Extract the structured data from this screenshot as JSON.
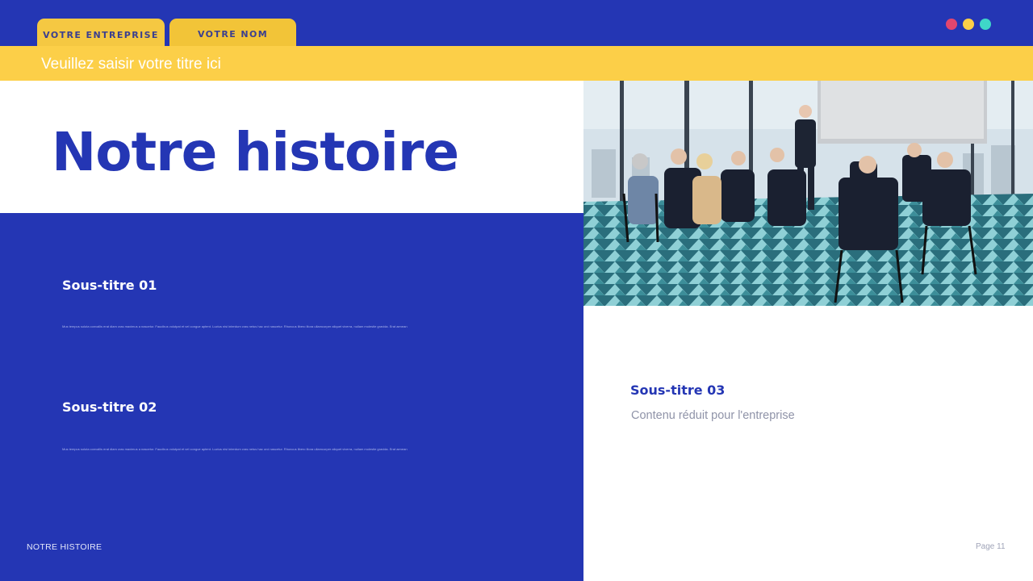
{
  "header": {
    "tab_company": "VOTRE ENTREPRISE",
    "tab_name": "VOTRE NOM",
    "band_title": "Veuillez saisir votre titre ici",
    "dots": [
      {
        "name": "pink-dot",
        "color": "#e2466e"
      },
      {
        "name": "yellow-dot",
        "color": "#fccf48"
      },
      {
        "name": "teal-dot",
        "color": "#3fd6c8"
      }
    ]
  },
  "main": {
    "title": "Notre histoire"
  },
  "sections": [
    {
      "subtitle": "Sous-titre 01",
      "body": "Mus tempus soluta convallis erat diam cras maximus a nascetur. Faucibus volutpat et vel congue aptent. Luctus nisi interdum cras netus hac orci nascetur. Rhoncus libero litora ullamcorper aliquet viverra, nullam molestie gravida. Erat aenean"
    },
    {
      "subtitle": "Sous-titre 02",
      "body": "Mus tempus soluta convallis erat diam cras maximus a nascetur. Faucibus volutpat et vel congue aptent. Luctus nisi interdum cras netus hac orci nascetur. Rhoncus libero litora ullamcorper aliquet viverra, nullam molestie gravida. Erat aenean"
    }
  ],
  "right_card": {
    "subtitle": "Sous-titre 03",
    "body": "Contenu réduit pour l'entreprise"
  },
  "footer": {
    "section_label": "NOTRE HISTOIRE",
    "page": "Page 11"
  },
  "colors": {
    "primary_blue": "#2436b4",
    "accent_yellow": "#fccf48"
  }
}
